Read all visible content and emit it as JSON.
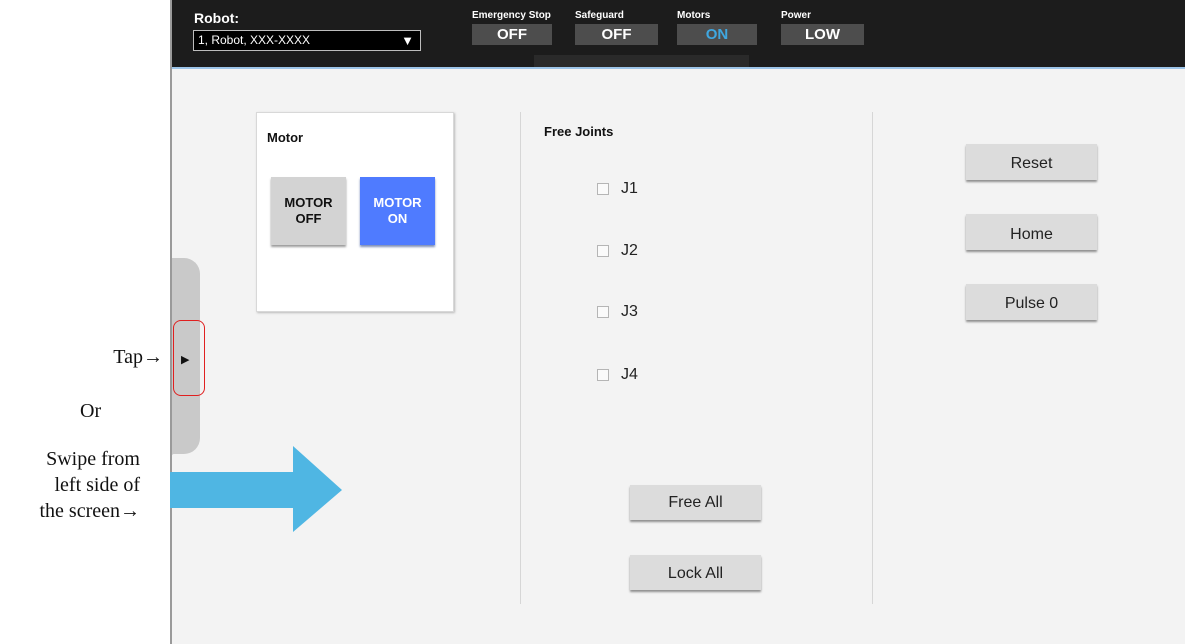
{
  "annotations": {
    "tap": "Tap→",
    "or": "Or",
    "swipe_line1": "Swipe from",
    "swipe_line2": "left side of",
    "swipe_line3": "the screen→"
  },
  "header": {
    "robot_label": "Robot:",
    "robot_select_value": "1, Robot, XXX-XXXX",
    "status": {
      "emergency_stop": {
        "label": "Emergency Stop",
        "value": "OFF"
      },
      "safeguard": {
        "label": "Safeguard",
        "value": "OFF"
      },
      "motors": {
        "label": "Motors",
        "value": "ON"
      },
      "power": {
        "label": "Power",
        "value": "LOW"
      }
    }
  },
  "motor_panel": {
    "title": "Motor",
    "off_label": "MOTOR\nOFF",
    "on_label": "MOTOR\nON"
  },
  "free_joints": {
    "title": "Free Joints",
    "joints": [
      "J1",
      "J2",
      "J3",
      "J4"
    ],
    "free_all": "Free All",
    "lock_all": "Lock All"
  },
  "actions": {
    "reset": "Reset",
    "home": "Home",
    "pulse": "Pulse 0"
  },
  "colors": {
    "accent_on": "#4f7bff",
    "motors_on_text": "#3fa7e0",
    "swipe_arrow": "#4fb6e3",
    "tap_highlight": "#e02020"
  }
}
